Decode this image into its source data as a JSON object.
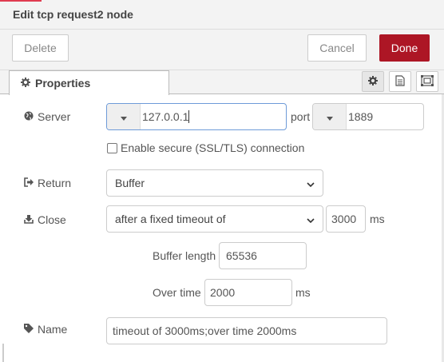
{
  "dialog": {
    "title": "Edit tcp request2 node"
  },
  "toolbar": {
    "delete_label": "Delete",
    "cancel_label": "Cancel",
    "done_label": "Done"
  },
  "tabs": {
    "properties_label": "Properties"
  },
  "form": {
    "server": {
      "label": "Server",
      "value": "127.0.0.1"
    },
    "port": {
      "label": "port",
      "value": "1889"
    },
    "secure": {
      "label": "Enable secure (SSL/TLS) connection",
      "checked": false
    },
    "return": {
      "label": "Return",
      "value": "Buffer"
    },
    "close": {
      "label": "Close",
      "value": "after a fixed timeout of",
      "timeout_value": "3000",
      "timeout_unit": "ms"
    },
    "buffer_length": {
      "label": "Buffer length",
      "value": "65536"
    },
    "over_time": {
      "label": "Over time",
      "value": "2000",
      "unit": "ms"
    },
    "name": {
      "label": "Name",
      "value": "timeout of 3000ms;over time 2000ms"
    }
  },
  "colors": {
    "accent": "#ad1625",
    "topline": "#e03c50",
    "focus": "#6e9bd8"
  },
  "icons": [
    "globe-icon",
    "sign-out-icon",
    "download-icon",
    "tag-icon",
    "gear-icon",
    "file-icon",
    "frame-icon",
    "chevron-down-icon",
    "caret-down-icon"
  ]
}
